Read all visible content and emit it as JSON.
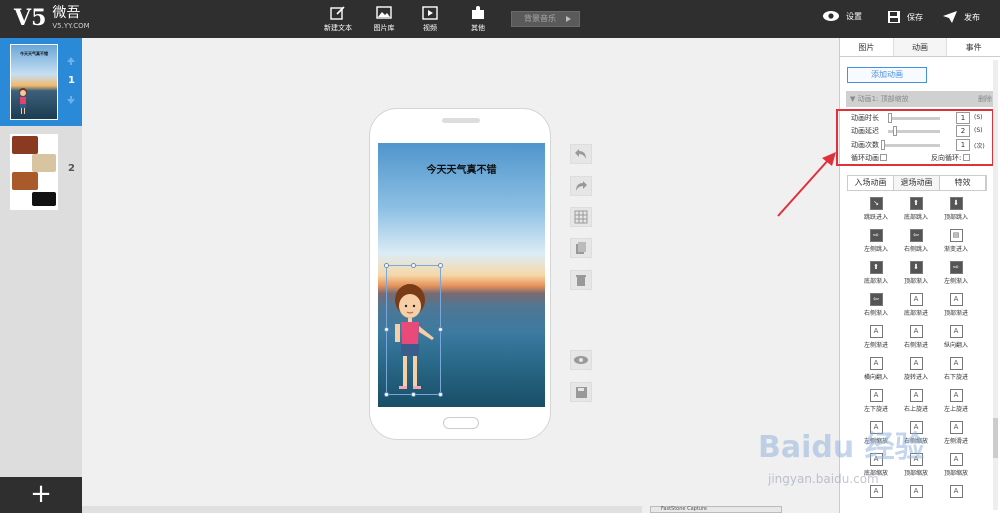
{
  "app": {
    "name": "微吾",
    "url": "V5.YY.COM"
  },
  "toolbar": {
    "new_text": "新建文本",
    "image_lib": "图片库",
    "video": "视频",
    "other": "其他",
    "music": "背景音乐",
    "settings": "设置",
    "save": "保存",
    "publish": "发布"
  },
  "slides": [
    {
      "num": "1",
      "title": "今天天气真不错"
    },
    {
      "num": "2"
    }
  ],
  "add_slide": "+",
  "screen": {
    "title": "今天天气真不错"
  },
  "right_tabs": [
    "图片",
    "动画",
    "事件"
  ],
  "add_animation": "添加动画",
  "anim_header": {
    "label": "▼ 动画1: 顶部缩放",
    "delete": "删除"
  },
  "props": {
    "duration_label": "动画时长",
    "duration_value": "1",
    "duration_unit": "(S)",
    "delay_label": "动画延迟",
    "delay_value": "2",
    "delay_unit": "(S)",
    "count_label": "动画次数",
    "count_value": "1",
    "count_unit": "(次)",
    "loop_label": "循环动画",
    "reverse_label": "反向循环:"
  },
  "sub_tabs": [
    "入场动画",
    "退场动画",
    "特效"
  ],
  "effects": [
    "跳跃进入",
    "底部跳入",
    "顶部跳入",
    "左侧跳入",
    "右侧跳入",
    "渐变进入",
    "底部渐入",
    "顶部渐入",
    "左侧渐入",
    "右侧渐入",
    "底部渐进",
    "顶部渐进",
    "左侧渐进",
    "右侧渐进",
    "纵向翻入",
    "横向翻入",
    "旋转进入",
    "右下旋进",
    "左下旋进",
    "右上旋进",
    "左上旋进",
    "左侧缩放",
    "右侧缩放",
    "左侧滑进",
    "底部缩放",
    "顶部缩放",
    "顶部缩放",
    "",
    "",
    ""
  ],
  "watermark": {
    "text": "Baidu 经验",
    "url": "jingyan.baidu.com"
  },
  "taskbar": "FastStone Capture"
}
